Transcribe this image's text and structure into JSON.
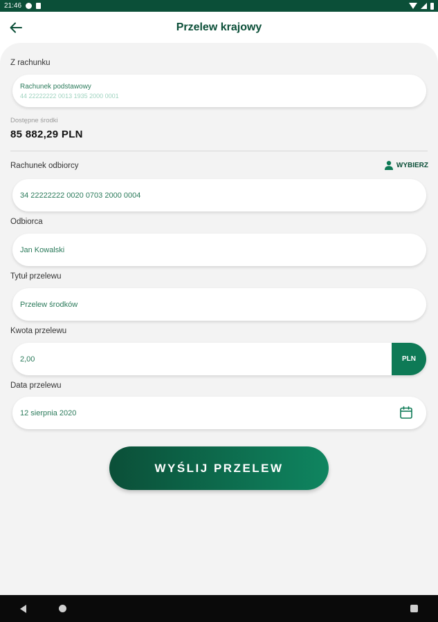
{
  "status_bar": {
    "time": "21:46"
  },
  "header": {
    "title": "Przelew krajowy",
    "back_icon": "arrow-left-icon"
  },
  "form": {
    "from_account_label": "Z rachunku",
    "from_account_name": "Rachunek podstawowy",
    "from_account_number": "44 22222222 0013 1935 2000 0001",
    "available_funds_label": "Dostępne środki",
    "available_funds_value": "85 882,29 PLN",
    "recipient_account_label": "Rachunek odbiorcy",
    "choose_label": "WYBIERZ",
    "recipient_account_value": "34 22222222 0020 0703 2000 0004",
    "recipient_label": "Odbiorca",
    "recipient_value": "Jan Kowalski",
    "title_label": "Tytuł przelewu",
    "title_value": "Przelew środków",
    "amount_label": "Kwota przelewu",
    "amount_value": "2,00",
    "currency": "PLN",
    "date_label": "Data przelewu",
    "date_value": "12 sierpnia 2020",
    "submit_label": "WYŚLIJ PRZELEW"
  },
  "colors": {
    "primary": "#0b4f38",
    "accent": "#0e7a56",
    "field_text": "#2a7a5a",
    "background": "#f3f3f3"
  }
}
